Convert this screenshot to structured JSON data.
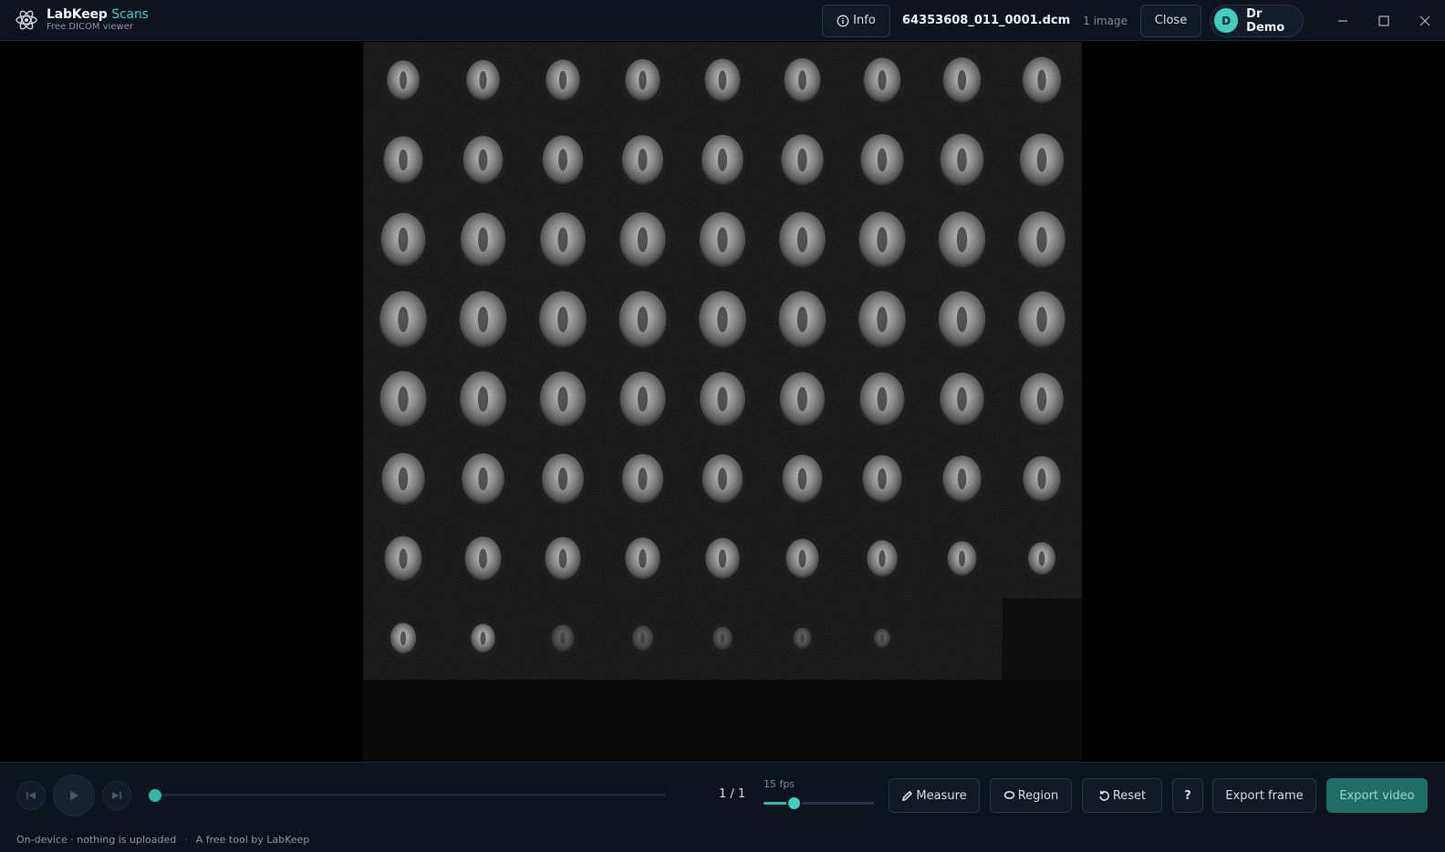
{
  "app": {
    "brand_name": "LabKeep",
    "brand_accent": "Scans",
    "brand_subtitle": "Free DICOM viewer",
    "logo_icon": "atom-icon"
  },
  "header": {
    "info_label": "Info",
    "filename": "64353608_011_0001.dcm",
    "image_count": "1 image",
    "close_label": "Close",
    "user_initial": "D",
    "user_name": "Dr Demo"
  },
  "viewer": {
    "mosaic_columns": 9,
    "mosaic_rows": 8,
    "slice_count": 70
  },
  "playback": {
    "frame_counter": "1 / 1",
    "fps_label": "15 fps",
    "fps_level": 0.28,
    "scrub_progress": 0
  },
  "toolbar": {
    "measure_label": "Measure",
    "region_label": "Region",
    "reset_label": "Reset",
    "help_label": "?",
    "export_frame_label": "Export frame",
    "export_video_label": "Export video"
  },
  "footer": {
    "privacy_note": "On-device · nothing is uploaded",
    "separator": "·",
    "credit": "A free tool by LabKeep"
  },
  "colors": {
    "accent": "#3ecfc0",
    "export_video_bg": "#1e6e67",
    "chrome_bg": "#0c131d"
  }
}
